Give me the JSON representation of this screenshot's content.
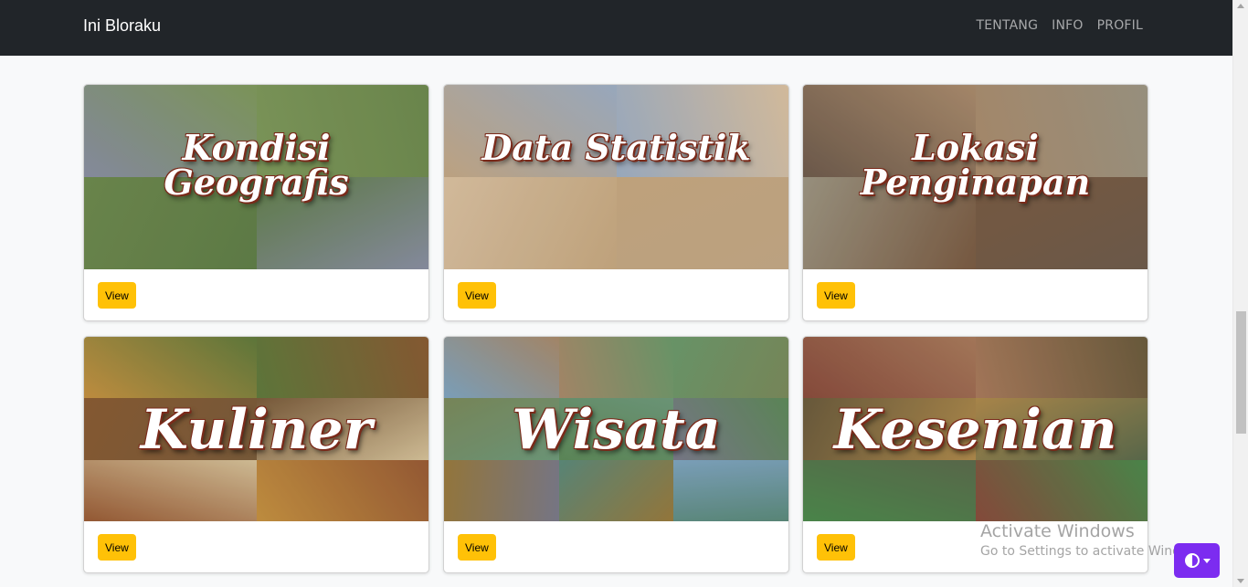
{
  "navbar": {
    "brand": "Ini Bloraku",
    "links": [
      "TENTANG",
      "INFO",
      "PROFIL"
    ]
  },
  "cards": [
    {
      "caption": "Kondisi Geografis",
      "button": "View",
      "colors": [
        "#7a7f93",
        "#6f8a4a",
        "#5d7a3c",
        "#4f6e36"
      ]
    },
    {
      "caption": "Data Statistik",
      "button": "View",
      "colors": [
        "#b69a76",
        "#8fa0b6",
        "#cdb392",
        "#b99a70"
      ]
    },
    {
      "caption": "Lokasi Penginapan",
      "button": "View",
      "colors": [
        "#5e4a3a",
        "#9c7c5c",
        "#8e8672",
        "#6a4a30"
      ]
    },
    {
      "caption": "Kuliner",
      "button": "View",
      "colors": [
        "#b8822e",
        "#4f6a2a",
        "#7a4a20",
        "#6a4a28",
        "#c9b48a",
        "#8a4a22"
      ]
    },
    {
      "caption": "Wisata",
      "button": "View",
      "colors": [
        "#6f96b2",
        "#9a7a5a",
        "#5b8a5a",
        "#6b7a4a",
        "#5e8a6a",
        "#4d7a48",
        "#6a6a7a",
        "#8a6a2a",
        "#4a7a6a"
      ]
    },
    {
      "caption": "Kesenian",
      "button": "View",
      "colors": [
        "#7a3a2a",
        "#9a6a4a",
        "#5a4a2a",
        "#a07a3a",
        "#4a5a3a",
        "#3a7a3a"
      ]
    }
  ],
  "watermark": {
    "title": "Activate Windows",
    "subtitle": "Go to Settings to activate Windows."
  },
  "theme_toggle": {
    "icon": "contrast-icon",
    "accent": "#7c2cf0"
  }
}
